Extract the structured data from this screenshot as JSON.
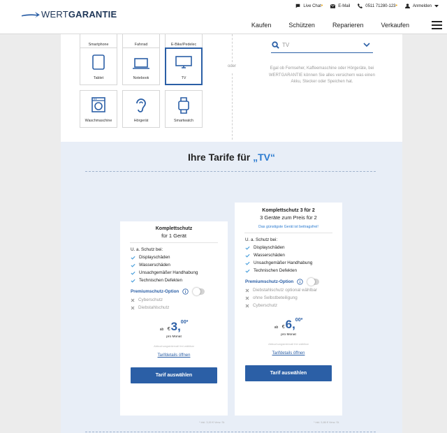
{
  "header": {
    "logo_light": "WERT",
    "logo_bold": "GARANTIE",
    "topbar": {
      "live_chat": "Live Chat",
      "email": "E-Mail",
      "phone": "0511 71280-123",
      "login": "Anmelden"
    },
    "nav": [
      "Kaufen",
      "Schützen",
      "Reparieren",
      "Verkaufen"
    ]
  },
  "devices": {
    "top_row_partial": [
      "Smartphone",
      "Fahrrad",
      "E-Bike/Pedelec"
    ],
    "row2": [
      "Tablet",
      "Notebook",
      "TV"
    ],
    "row3": [
      "Waschmaschine",
      "Hörgerät",
      "Smartwatch"
    ],
    "selected": "TV"
  },
  "separator": "oder",
  "search": {
    "value": "TV",
    "hint": "Egal ob Fernseher, Kaffeemaschine oder Hörgeräte, bei WERTGARANTIE können Sie alles versichern was einen Akku, Stecker oder Speichen hat."
  },
  "tariffs": {
    "title_prefix": "Ihre Tarife für ",
    "title_device": "„TV“",
    "cards": [
      {
        "title": "Komplettschutz",
        "subtitle": "für 1 Gerät",
        "badge": "",
        "scope": "U. a. Schutz bei:",
        "features": [
          "Displayschäden",
          "Wasserschäden",
          "Unsachgemäßer Handhabung",
          "Technischen Defekten"
        ],
        "premium_label": "Premiumschutz-Option",
        "premium_enabled": false,
        "extras": [
          "Cyberschutz",
          "Diebstahlschutz"
        ],
        "price_prefix": "ab",
        "currency": "€",
        "price_int": "3,",
        "price_dec": "00*",
        "period": "pro Monat",
        "billing": "Abbuchungsintervall frei wählbar",
        "details_link": "Tarifdetails öffnen",
        "cta": "Tarif auswählen",
        "footnote": "* inkl. 3,00 € Verw. St."
      },
      {
        "title": "Komplettschutz 3 für 2",
        "subtitle": "3 Geräte zum Preis für 2",
        "badge": "Das günstigste Gerät ist beitragsfrei!",
        "scope": "U. a. Schutz bei:",
        "features": [
          "Displayschäden",
          "Wasserschäden",
          "Unsachgemäßer Handhabung",
          "Technischen Defekten"
        ],
        "premium_label": "Premiumschutz-Option",
        "premium_enabled": false,
        "extras": [
          "Diebstahlschutz optional wählbar",
          "ohne Selbstbeteiligung",
          "Cyberschutz"
        ],
        "price_prefix": "ab",
        "currency": "€",
        "price_int": "6,",
        "price_dec": "00*",
        "period": "pro Monat",
        "billing": "Abbuchungsintervall frei wählbar",
        "details_link": "Tarifdetails öffnen",
        "cta": "Tarif auswählen",
        "footnote": "* inkl. 5,86 € Verw. St."
      }
    ]
  },
  "colors": {
    "brand_blue": "#2b5fa6",
    "accent_blue": "#2b7bd0",
    "check_blue": "#4a9fdc",
    "section_bg": "#e8eef7"
  }
}
